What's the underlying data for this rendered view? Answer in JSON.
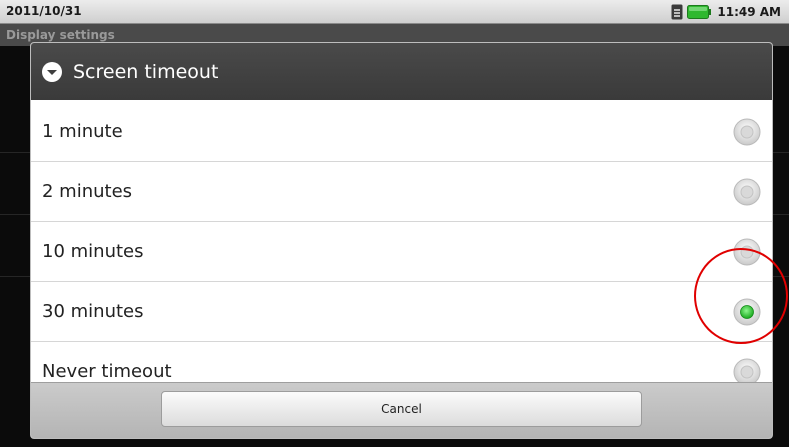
{
  "status_bar": {
    "date": "2011/10/31",
    "time": "11:49 AM",
    "icons": [
      "sim-card-icon",
      "battery-icon"
    ],
    "battery_color": "#2fb82f"
  },
  "background_screen": {
    "title": "Display settings"
  },
  "dialog": {
    "title": "Screen timeout",
    "header_icon": "circle-chevron-down-icon",
    "options": [
      {
        "label": "1 minute",
        "selected": false
      },
      {
        "label": "2 minutes",
        "selected": false
      },
      {
        "label": "10 minutes",
        "selected": false
      },
      {
        "label": "30 minutes",
        "selected": true
      },
      {
        "label": "Never timeout",
        "selected": false
      }
    ],
    "cancel_label": "Cancel"
  },
  "annotation": {
    "color": "#e00000",
    "target": "30 minutes"
  },
  "colors": {
    "selected_radio": "#29c12e",
    "header_bg": "#404040",
    "dialog_bg": "#ffffff"
  }
}
